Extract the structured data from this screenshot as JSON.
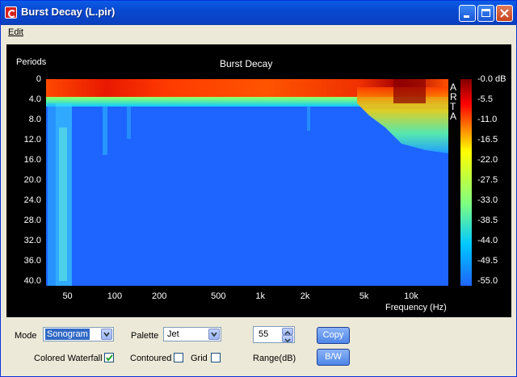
{
  "window": {
    "title": "Burst Decay  (L.pir)"
  },
  "menu": {
    "edit": "Edit"
  },
  "plot": {
    "title": "Burst Decay",
    "ylabel": "Periods",
    "xlabel": "Frequency (Hz)",
    "watermark": [
      "A",
      "R",
      "T",
      "A"
    ],
    "y_ticks": [
      "0",
      "4.0",
      "8.0",
      "12.0",
      "16.0",
      "20.0",
      "24.0",
      "28.0",
      "32.0",
      "36.0",
      "40.0"
    ],
    "x_ticks": [
      "50",
      "100",
      "200",
      "500",
      "1k",
      "2k",
      "5k",
      "10k"
    ],
    "colorbar": [
      "-0.0 dB",
      "-5.5",
      "-11.0",
      "-16.5",
      "-22.0",
      "-27.5",
      "-33.0",
      "-38.5",
      "-44.0",
      "-49.5",
      "-55.0"
    ],
    "colors": {
      "background": "#1e64ff",
      "palette_low": "#1e64ff",
      "palette_high": "#800000"
    }
  },
  "controls": {
    "mode_label": "Mode",
    "mode_value": "Sonogram",
    "palette_label": "Palette",
    "palette_value": "Jet",
    "range_value": "55",
    "range_label": "Range(dB)",
    "copy_label": "Copy",
    "bw_label": "B/W",
    "colored_waterfall_label": "Colored Waterfall",
    "contoured_label": "Contoured",
    "grid_label": "Grid"
  }
}
